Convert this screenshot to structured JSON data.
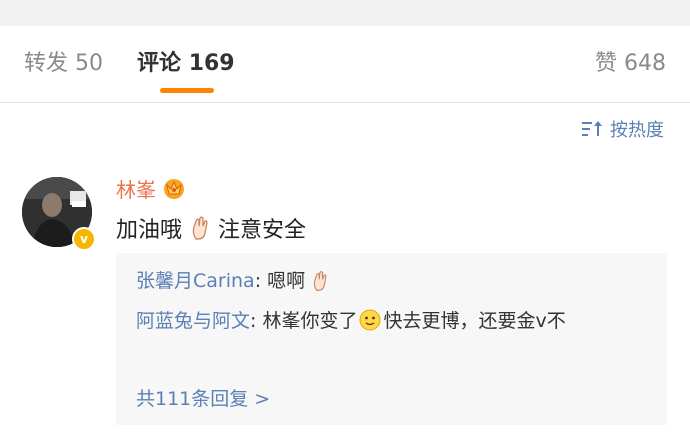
{
  "tabs": {
    "repost_label": "转发",
    "repost_count": "50",
    "comments_label": "评论",
    "comments_count": "169",
    "likes_label": "赞",
    "likes_count": "648",
    "accent_color": "#ff8200"
  },
  "sort": {
    "label": "按热度",
    "icon": "sort-icon"
  },
  "comment": {
    "username": "林峯",
    "badge_icon": "member-crown-icon",
    "verified_icon": "verified-v-icon",
    "verified_label": "v",
    "text_part1": "加油哦",
    "emoji_1": "hand-gesture-emoji",
    "text_part2": "注意安全",
    "replies": [
      {
        "name": "张馨月Carina",
        "separator": ": ",
        "text": "嗯啊",
        "emoji": "hand-gesture-emoji"
      },
      {
        "name": "阿蓝兔与阿文",
        "separator": ": ",
        "text_part1": "林峯你变了",
        "emoji": "face-emoji",
        "text_part2": "快去更博，还要金v不"
      }
    ],
    "more_replies_label": "共111条回复 >"
  },
  "colors": {
    "username": "#eb7350",
    "link": "#5b80b5",
    "reply_background": "#f7f7f7"
  }
}
